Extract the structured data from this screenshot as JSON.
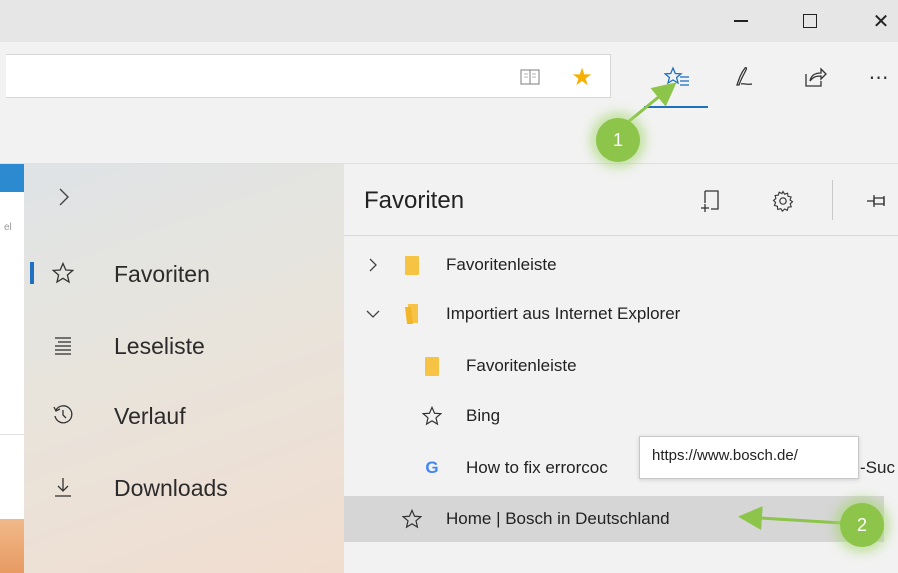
{
  "window": {
    "minimize_icon": "minimize-icon",
    "maximize_icon": "maximize-icon",
    "close_glyph": "✕"
  },
  "toolbar": {
    "reading_view_icon": "book-icon",
    "favorite_star_icon": "star-icon",
    "star_glyph": "★",
    "hub_icon": "favorites-hub-icon",
    "notes_icon": "pen-icon",
    "share_icon": "share-icon",
    "more_glyph": "⋯",
    "hub_accent": "#1f70c1",
    "star_color": "#f6b100"
  },
  "hub_nav": {
    "items": [
      {
        "label": "Favoriten",
        "icon": "star-outline-icon",
        "glyph": "☆",
        "selected": true
      },
      {
        "label": "Leseliste",
        "icon": "reading-list-icon",
        "glyph": "≣"
      },
      {
        "label": "Verlauf",
        "icon": "history-icon",
        "glyph": "⟲"
      },
      {
        "label": "Downloads",
        "icon": "download-icon",
        "glyph": "↓"
      }
    ]
  },
  "favorites": {
    "title": "Favoriten",
    "rows": [
      {
        "label": "Favoritenleiste",
        "icon": "folder-icon",
        "expander": "collapsed"
      },
      {
        "label": "Importiert aus Internet Explorer",
        "icon": "folder-open-icon",
        "expander": "expanded"
      },
      {
        "label": "Favoritenleiste",
        "icon": "folder-icon",
        "indent": 1
      },
      {
        "label": "Bing",
        "icon": "star-outline-icon",
        "glyph": "☆",
        "indent": 1
      },
      {
        "label": "How to fix errorcoc",
        "trailing": "-Suc",
        "icon": "google-icon",
        "glyph": "G",
        "indent": 1
      },
      {
        "label": "Home | Bosch in Deutschland",
        "icon": "star-outline-icon",
        "glyph": "☆",
        "selected": true
      }
    ],
    "tooltip": "https://www.bosch.de/"
  },
  "annotations": {
    "marker_1": "1",
    "marker_2": "2",
    "color": "#8cc54a"
  }
}
